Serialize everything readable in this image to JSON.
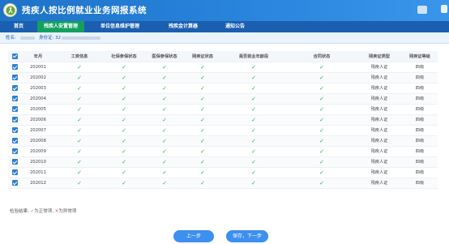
{
  "header": {
    "title": "残疾人按比例就业业务网报系统",
    "brand_color": "#1e73c8"
  },
  "nav": {
    "items": [
      {
        "label": "首页",
        "active": false
      },
      {
        "label": "残疾人安置管理",
        "active": true
      },
      {
        "label": "单位信息维护管理",
        "active": false
      },
      {
        "label": "残疾金计算器",
        "active": false
      },
      {
        "label": "通知公告",
        "active": false
      }
    ]
  },
  "userbar": {
    "name_label": "姓名:",
    "id_label": "身份证:",
    "id_prefix": "32"
  },
  "table": {
    "headers": [
      "",
      "年月",
      "工资信息",
      "社保参保状态",
      "医保参保状态",
      "残疾证状态",
      "是否就业年龄段",
      "合同状态",
      "残疾证类型",
      "残疾证等级"
    ],
    "rows": [
      {
        "month": "202001",
        "type": "残疾人证",
        "level": "四级"
      },
      {
        "month": "202002",
        "type": "残疾人证",
        "level": "四级"
      },
      {
        "month": "202003",
        "type": "残疾人证",
        "level": "四级"
      },
      {
        "month": "202004",
        "type": "残疾人证",
        "level": "四级"
      },
      {
        "month": "202005",
        "type": "残疾人证",
        "level": "四级"
      },
      {
        "month": "202006",
        "type": "残疾人证",
        "level": "四级"
      },
      {
        "month": "202007",
        "type": "残疾人证",
        "level": "四级"
      },
      {
        "month": "202008",
        "type": "残疾人证",
        "level": "四级"
      },
      {
        "month": "202009",
        "type": "残疾人证",
        "level": "四级"
      },
      {
        "month": "202010",
        "type": "残疾人证",
        "level": "四级"
      },
      {
        "month": "202011",
        "type": "残疾人证",
        "level": "四级"
      },
      {
        "month": "202012",
        "type": "残疾人证",
        "level": "四级"
      }
    ],
    "check_glyph": "✓"
  },
  "legend": {
    "prefix": "检验结果:",
    "ok_glyph": "✓",
    "ok_text": "为正常项,",
    "bad_glyph": "✕",
    "bad_text": "为异常项"
  },
  "buttons": {
    "prev": "上一步",
    "next": "保存，下一步"
  },
  "colors": {
    "nav_active": "#13a05f",
    "check_ok": "#2fae5d",
    "check_bad": "#e04a4a",
    "button": "#3d8ff0"
  }
}
